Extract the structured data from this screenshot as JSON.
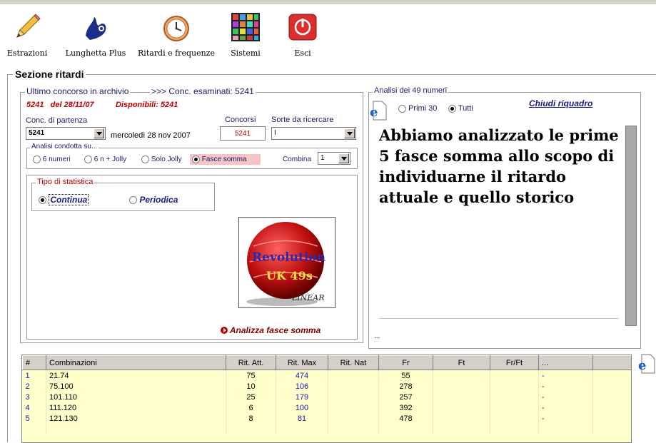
{
  "toolbar": {
    "items": [
      {
        "label": "Estrazioni",
        "icon": "pencil-icon"
      },
      {
        "label": "Lunghetta Plus",
        "icon": "lottery-hand-icon"
      },
      {
        "label": "Ritardi e frequenze",
        "icon": "clock-icon"
      },
      {
        "label": "Sistemi",
        "icon": "color-grid-icon"
      },
      {
        "label": "Esci",
        "icon": "power-icon"
      }
    ]
  },
  "section_title": "Sezione ritardi",
  "archive": {
    "legend": "Ultimo concorso in archivio",
    "examined": ">>> Conc. esaminati: 5241",
    "last": "5241   del 28/11/07",
    "available": "Disponibili: 5241",
    "start_label": "Conc. di partenza",
    "start_value": "5241",
    "start_date": "mercoledì 28 nov 2007",
    "concorsi_label": "Concorsi",
    "concorsi_value": "5241",
    "sorte_label": "Sorte da ricercare",
    "sorte_value": "I"
  },
  "analysis": {
    "legend": "Analisi condotta su...",
    "options": [
      "6 numeri",
      "6 n + Jolly",
      "Solo Jolly",
      "Fasce somma"
    ],
    "selected": 3,
    "combina_label": "Combina",
    "combina_value": "1"
  },
  "stat_type": {
    "legend": "Tipo di statistica",
    "options": [
      "Continua",
      "Periodica"
    ],
    "selected": 0
  },
  "logo": {
    "line1": "Revolution",
    "line2": "UK 49s",
    "line3": "LINEAR"
  },
  "analyze_button": "Analizza fasce somma",
  "right_panel": {
    "legend": "Analisi dei 49 numeri",
    "options": [
      "Primi 30",
      "Tutti"
    ],
    "selected": 1,
    "close_link": "Chiudi riquadro",
    "message": "Abbiamo analizzato le prime 5 fasce somma allo scopo di individuarne il ritardo attuale e quello storico",
    "footer": "..."
  },
  "table": {
    "headers": [
      "#",
      "Combinazioni",
      "Rit. Att.",
      "Rit. Max",
      "Rit. Nat",
      "Fr",
      "Ft",
      "Fr/Ft",
      "..."
    ],
    "rows": [
      {
        "n": "1",
        "comb": "21.74",
        "att": "75",
        "max": "474",
        "nat": "",
        "fr": "55",
        "ft": "",
        "frft": "",
        "x": "-"
      },
      {
        "n": "2",
        "comb": "75.100",
        "att": "10",
        "max": "106",
        "nat": "",
        "fr": "278",
        "ft": "",
        "frft": "",
        "x": "-"
      },
      {
        "n": "3",
        "comb": "101.110",
        "att": "25",
        "max": "179",
        "nat": "",
        "fr": "257",
        "ft": "",
        "frft": "",
        "x": "-"
      },
      {
        "n": "4",
        "comb": "111.120",
        "att": "6",
        "max": "100",
        "nat": "",
        "fr": "392",
        "ft": "",
        "frft": "",
        "x": "-"
      },
      {
        "n": "5",
        "comb": "121.130",
        "att": "8",
        "max": "81",
        "nat": "",
        "fr": "478",
        "ft": "",
        "frft": "",
        "x": "-"
      }
    ]
  }
}
